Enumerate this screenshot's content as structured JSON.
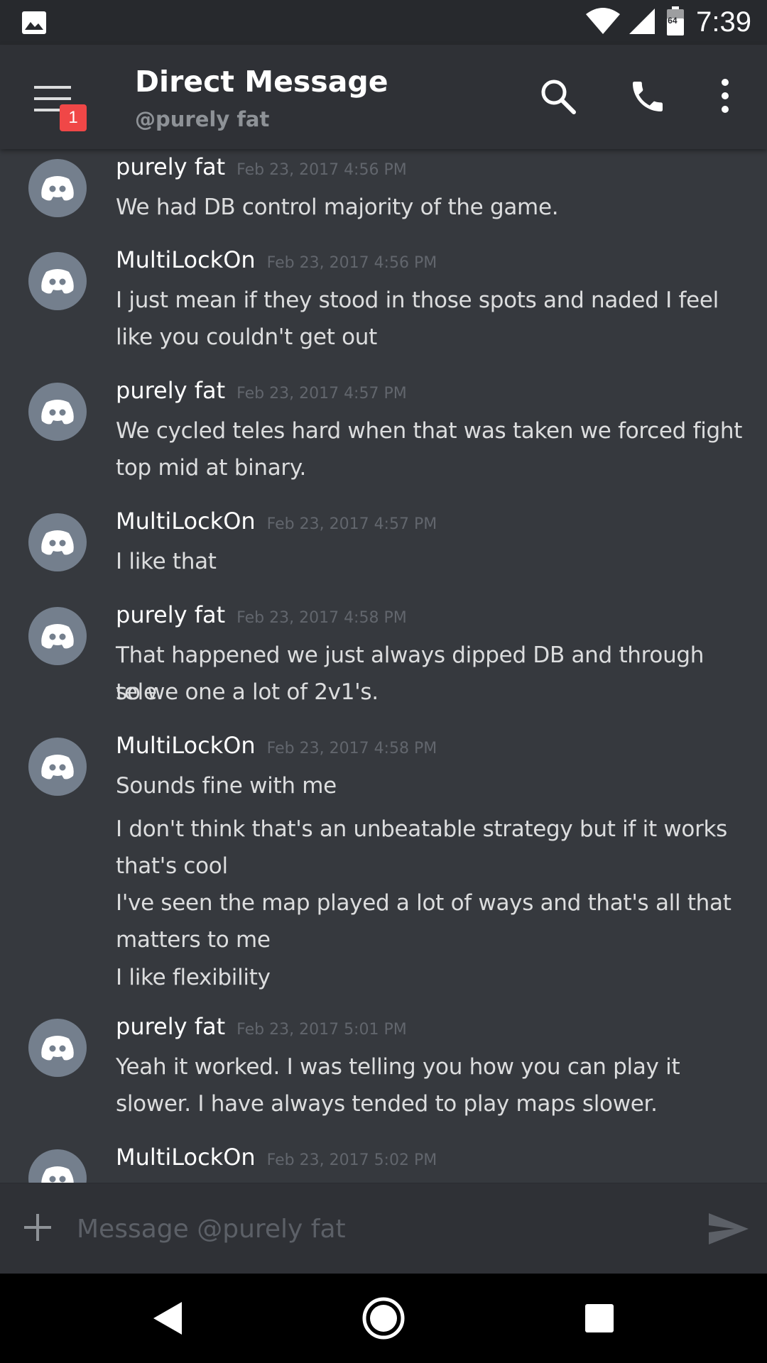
{
  "status_bar": {
    "time": "7:39",
    "battery_level": "64",
    "icons": [
      "image-icon",
      "wifi-icon",
      "cell-signal-icon",
      "battery-icon"
    ]
  },
  "header": {
    "title": "Direct Message",
    "subtitle": "@purely fat",
    "menu_badge": "1",
    "icons": [
      "menu-icon",
      "search-icon",
      "phone-icon",
      "more-vertical-icon"
    ]
  },
  "messages": [
    {
      "author": "purely fat",
      "timestamp": "Feb 23, 2017 4:56 PM",
      "lines": [
        "We had DB control majority of the game."
      ]
    },
    {
      "author": "MultiLockOn",
      "timestamp": "Feb 23, 2017 4:56 PM",
      "lines": [
        "I just mean if they stood in those spots and naded I feel",
        "like you couldn't get out"
      ]
    },
    {
      "author": "purely fat",
      "timestamp": "Feb 23, 2017 4:57 PM",
      "lines": [
        "We cycled teles hard when that was taken we forced fight",
        "top mid at binary."
      ]
    },
    {
      "author": "MultiLockOn",
      "timestamp": "Feb 23, 2017 4:57 PM",
      "lines": [
        "I like that"
      ]
    },
    {
      "author": "purely fat",
      "timestamp": "Feb 23, 2017 4:58 PM",
      "lines": [
        "That happened we just always dipped DB and through tele",
        "so we one a lot of 2v1's."
      ]
    },
    {
      "author": "MultiLockOn",
      "timestamp": "Feb 23, 2017 4:58 PM",
      "lines": [
        "Sounds fine with me",
        "I don't think that's an unbeatable strategy but if it works",
        "that's cool",
        "I've seen the map played a lot of ways and that's all that",
        "matters to me",
        "I like flexibility"
      ]
    },
    {
      "author": "purely fat",
      "timestamp": "Feb 23, 2017 5:01 PM",
      "lines": [
        "Yeah it worked. I was telling you how you can play it",
        "slower. I have always tended to play maps slower."
      ]
    },
    {
      "author": "MultiLockOn",
      "timestamp": "Feb 23, 2017 5:02 PM",
      "lines": []
    }
  ],
  "composer": {
    "placeholder": "Message @purely fat",
    "icons": [
      "plus-icon",
      "send-icon"
    ]
  },
  "nav_bar": {
    "icons": [
      "back-icon",
      "home-icon",
      "recents-icon"
    ]
  },
  "colors": {
    "background": "#36393e",
    "header": "#2f3136",
    "status_bar": "#27292d",
    "avatar": "#747f8d",
    "badge": "#f04747",
    "timestamp": "#62666d",
    "message_text": "#dcddde"
  }
}
